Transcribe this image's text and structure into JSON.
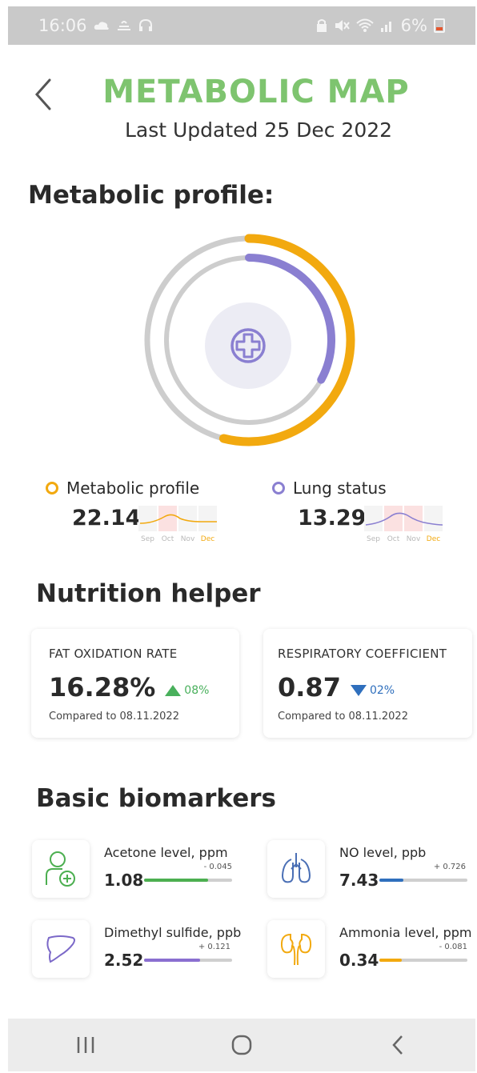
{
  "status_bar": {
    "time": "16:06",
    "battery": "6%",
    "left_icons": [
      "cloud-icon",
      "weather-icon",
      "headphones-icon"
    ],
    "right_icons": [
      "lock-icon",
      "mute-icon",
      "wifi-icon",
      "signal-icon"
    ]
  },
  "header": {
    "title": "METABOLIC MAP",
    "subtitle": "Last Updated 25 Dec 2022",
    "title_color": "#7ec46f"
  },
  "metabolic_profile": {
    "section_title": "Metabolic profile:",
    "outer_ring_fraction": 0.54,
    "inner_ring_fraction": 0.33,
    "outer_color": "#f2a90f",
    "inner_color": "#8a7fd1",
    "center_icon": "plus-circle-icon",
    "metrics": [
      {
        "label": "Metabolic profile",
        "value": "22.14",
        "color": "#f2a90f",
        "months": [
          "Sep",
          "Oct",
          "Nov",
          "Dec"
        ],
        "highlight_months": [
          "Oct"
        ],
        "active_month": "Dec"
      },
      {
        "label": "Lung status",
        "value": "13.29",
        "color": "#8a7fd1",
        "months": [
          "Sep",
          "Oct",
          "Nov",
          "Dec"
        ],
        "highlight_months": [
          "Oct",
          "Nov"
        ],
        "active_month": "Dec"
      }
    ]
  },
  "nutrition": {
    "section_title": "Nutrition helper",
    "cards": [
      {
        "label": "FAT OXIDATION RATE",
        "value": "16.28%",
        "delta": "08%",
        "direction": "up",
        "compare": "Compared to 08.11.2022"
      },
      {
        "label": "RESPIRATORY COEFFICIENT",
        "value": "0.87",
        "delta": "02%",
        "direction": "down",
        "compare": "Compared to 08.11.2022"
      }
    ]
  },
  "biomarkers": {
    "section_title": "Basic biomarkers",
    "items": [
      {
        "name": "Acetone level, ppm",
        "value": "1.08",
        "delta": "- 0.045",
        "fill_fraction": 0.73,
        "color": "#4caf50",
        "icon": "person-plus-icon"
      },
      {
        "name": "NO level, ppb",
        "value": "7.43",
        "delta": "+ 0.726",
        "fill_fraction": 0.27,
        "color": "#2f6fbd",
        "icon": "lungs-icon"
      },
      {
        "name": "Dimethyl sulfide, ppb",
        "value": "2.52",
        "delta": "+ 0.121",
        "fill_fraction": 0.64,
        "color": "#8a6fd0",
        "icon": "liver-icon"
      },
      {
        "name": "Ammonia level, ppm",
        "value": "0.34",
        "delta": "- 0.081",
        "fill_fraction": 0.25,
        "color": "#f2a90f",
        "icon": "kidneys-icon"
      }
    ]
  },
  "navbar": {
    "items": [
      "recent-apps-icon",
      "home-icon",
      "back-icon"
    ]
  }
}
